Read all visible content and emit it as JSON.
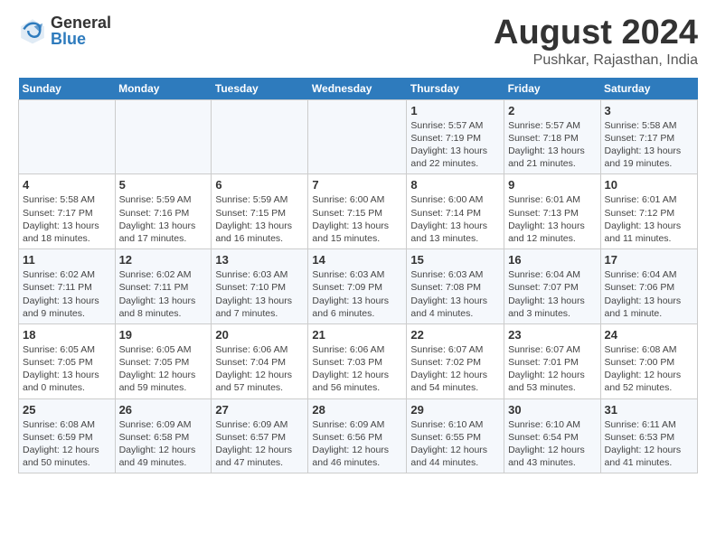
{
  "logo": {
    "general": "General",
    "blue": "Blue"
  },
  "title": "August 2024",
  "location": "Pushkar, Rajasthan, India",
  "headers": [
    "Sunday",
    "Monday",
    "Tuesday",
    "Wednesday",
    "Thursday",
    "Friday",
    "Saturday"
  ],
  "weeks": [
    [
      {
        "day": "",
        "info": ""
      },
      {
        "day": "",
        "info": ""
      },
      {
        "day": "",
        "info": ""
      },
      {
        "day": "",
        "info": ""
      },
      {
        "day": "1",
        "info": "Sunrise: 5:57 AM\nSunset: 7:19 PM\nDaylight: 13 hours\nand 22 minutes."
      },
      {
        "day": "2",
        "info": "Sunrise: 5:57 AM\nSunset: 7:18 PM\nDaylight: 13 hours\nand 21 minutes."
      },
      {
        "day": "3",
        "info": "Sunrise: 5:58 AM\nSunset: 7:17 PM\nDaylight: 13 hours\nand 19 minutes."
      }
    ],
    [
      {
        "day": "4",
        "info": "Sunrise: 5:58 AM\nSunset: 7:17 PM\nDaylight: 13 hours\nand 18 minutes."
      },
      {
        "day": "5",
        "info": "Sunrise: 5:59 AM\nSunset: 7:16 PM\nDaylight: 13 hours\nand 17 minutes."
      },
      {
        "day": "6",
        "info": "Sunrise: 5:59 AM\nSunset: 7:15 PM\nDaylight: 13 hours\nand 16 minutes."
      },
      {
        "day": "7",
        "info": "Sunrise: 6:00 AM\nSunset: 7:15 PM\nDaylight: 13 hours\nand 15 minutes."
      },
      {
        "day": "8",
        "info": "Sunrise: 6:00 AM\nSunset: 7:14 PM\nDaylight: 13 hours\nand 13 minutes."
      },
      {
        "day": "9",
        "info": "Sunrise: 6:01 AM\nSunset: 7:13 PM\nDaylight: 13 hours\nand 12 minutes."
      },
      {
        "day": "10",
        "info": "Sunrise: 6:01 AM\nSunset: 7:12 PM\nDaylight: 13 hours\nand 11 minutes."
      }
    ],
    [
      {
        "day": "11",
        "info": "Sunrise: 6:02 AM\nSunset: 7:11 PM\nDaylight: 13 hours\nand 9 minutes."
      },
      {
        "day": "12",
        "info": "Sunrise: 6:02 AM\nSunset: 7:11 PM\nDaylight: 13 hours\nand 8 minutes."
      },
      {
        "day": "13",
        "info": "Sunrise: 6:03 AM\nSunset: 7:10 PM\nDaylight: 13 hours\nand 7 minutes."
      },
      {
        "day": "14",
        "info": "Sunrise: 6:03 AM\nSunset: 7:09 PM\nDaylight: 13 hours\nand 6 minutes."
      },
      {
        "day": "15",
        "info": "Sunrise: 6:03 AM\nSunset: 7:08 PM\nDaylight: 13 hours\nand 4 minutes."
      },
      {
        "day": "16",
        "info": "Sunrise: 6:04 AM\nSunset: 7:07 PM\nDaylight: 13 hours\nand 3 minutes."
      },
      {
        "day": "17",
        "info": "Sunrise: 6:04 AM\nSunset: 7:06 PM\nDaylight: 13 hours\nand 1 minute."
      }
    ],
    [
      {
        "day": "18",
        "info": "Sunrise: 6:05 AM\nSunset: 7:05 PM\nDaylight: 13 hours\nand 0 minutes."
      },
      {
        "day": "19",
        "info": "Sunrise: 6:05 AM\nSunset: 7:05 PM\nDaylight: 12 hours\nand 59 minutes."
      },
      {
        "day": "20",
        "info": "Sunrise: 6:06 AM\nSunset: 7:04 PM\nDaylight: 12 hours\nand 57 minutes."
      },
      {
        "day": "21",
        "info": "Sunrise: 6:06 AM\nSunset: 7:03 PM\nDaylight: 12 hours\nand 56 minutes."
      },
      {
        "day": "22",
        "info": "Sunrise: 6:07 AM\nSunset: 7:02 PM\nDaylight: 12 hours\nand 54 minutes."
      },
      {
        "day": "23",
        "info": "Sunrise: 6:07 AM\nSunset: 7:01 PM\nDaylight: 12 hours\nand 53 minutes."
      },
      {
        "day": "24",
        "info": "Sunrise: 6:08 AM\nSunset: 7:00 PM\nDaylight: 12 hours\nand 52 minutes."
      }
    ],
    [
      {
        "day": "25",
        "info": "Sunrise: 6:08 AM\nSunset: 6:59 PM\nDaylight: 12 hours\nand 50 minutes."
      },
      {
        "day": "26",
        "info": "Sunrise: 6:09 AM\nSunset: 6:58 PM\nDaylight: 12 hours\nand 49 minutes."
      },
      {
        "day": "27",
        "info": "Sunrise: 6:09 AM\nSunset: 6:57 PM\nDaylight: 12 hours\nand 47 minutes."
      },
      {
        "day": "28",
        "info": "Sunrise: 6:09 AM\nSunset: 6:56 PM\nDaylight: 12 hours\nand 46 minutes."
      },
      {
        "day": "29",
        "info": "Sunrise: 6:10 AM\nSunset: 6:55 PM\nDaylight: 12 hours\nand 44 minutes."
      },
      {
        "day": "30",
        "info": "Sunrise: 6:10 AM\nSunset: 6:54 PM\nDaylight: 12 hours\nand 43 minutes."
      },
      {
        "day": "31",
        "info": "Sunrise: 6:11 AM\nSunset: 6:53 PM\nDaylight: 12 hours\nand 41 minutes."
      }
    ]
  ]
}
